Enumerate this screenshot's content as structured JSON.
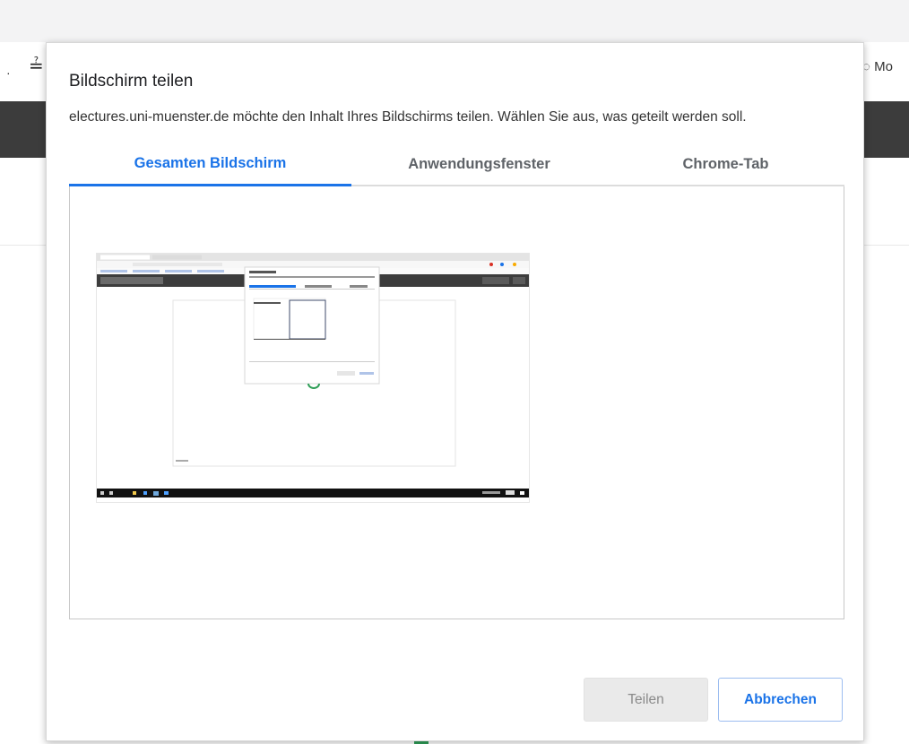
{
  "background": {
    "right_label": "Mo"
  },
  "dialog": {
    "title": "Bildschirm teilen",
    "description": "electures.uni-muenster.de möchte den Inhalt Ihres Bildschirms teilen. Wählen Sie aus, was geteilt werden soll.",
    "tabs": [
      {
        "label": "Gesamten Bildschirm",
        "active": true
      },
      {
        "label": "Anwendungsfenster",
        "active": false
      },
      {
        "label": "Chrome-Tab",
        "active": false
      }
    ],
    "share_label": "Teilen",
    "cancel_label": "Abbrechen"
  },
  "colors": {
    "accent": "#1a73e8",
    "dark_header": "#3c3c3c",
    "share_disabled_bg": "#eaeaea"
  }
}
